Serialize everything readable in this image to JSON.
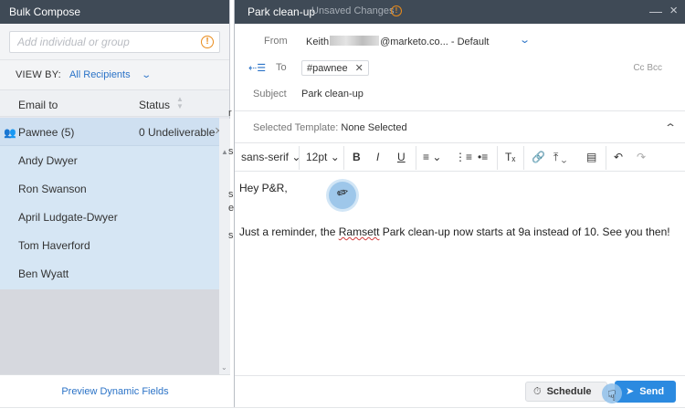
{
  "left_panel": {
    "title": "Bulk Compose",
    "search_placeholder": "Add individual or group",
    "view_by_label": "VIEW BY:",
    "view_by_value": "All Recipients",
    "col_email": "Email to",
    "col_status": "Status",
    "group": {
      "name": "Pawnee (5)",
      "status": "0 Undeliverable"
    },
    "recipients": [
      "Andy Dwyer",
      "Ron Swanson",
      "April Ludgate-Dwyer",
      "Tom Haverford",
      "Ben Wyatt"
    ],
    "footer_link": "Preview Dynamic Fields"
  },
  "gap_fragments": [
    "r",
    "s",
    "s",
    "e",
    "s"
  ],
  "composer": {
    "title": "Park clean-up",
    "unsaved": "Unsaved Changes",
    "from_label": "From",
    "from_name": "Keith",
    "from_rest": "@marketo.co... - Default",
    "to_label": "To",
    "to_chip": "#pawnee",
    "cc_bcc": "Cc Bcc",
    "subject_label": "Subject",
    "subject_value": "Park clean-up",
    "template_label": "Selected Template:",
    "template_value": "None Selected",
    "toolbar": {
      "font": "sans-serif",
      "size": "12pt",
      "bold": "B",
      "italic": "I",
      "underline": "U"
    },
    "body_greeting": "Hey P&R,",
    "body_msg_before": "Just a reminder, the ",
    "body_msg_misspelled": "Ramsett",
    "body_msg_after": " Park clean-up now starts at 9a instead of 10. See you then!",
    "schedule_label": "Schedule",
    "send_label": "Send"
  },
  "colors": {
    "header_bg": "#3f4a56",
    "accent": "#2b73c7",
    "send_bg": "#2b8ae0",
    "warning": "#e98b1b",
    "selected_rows": "#d6e6f4"
  }
}
